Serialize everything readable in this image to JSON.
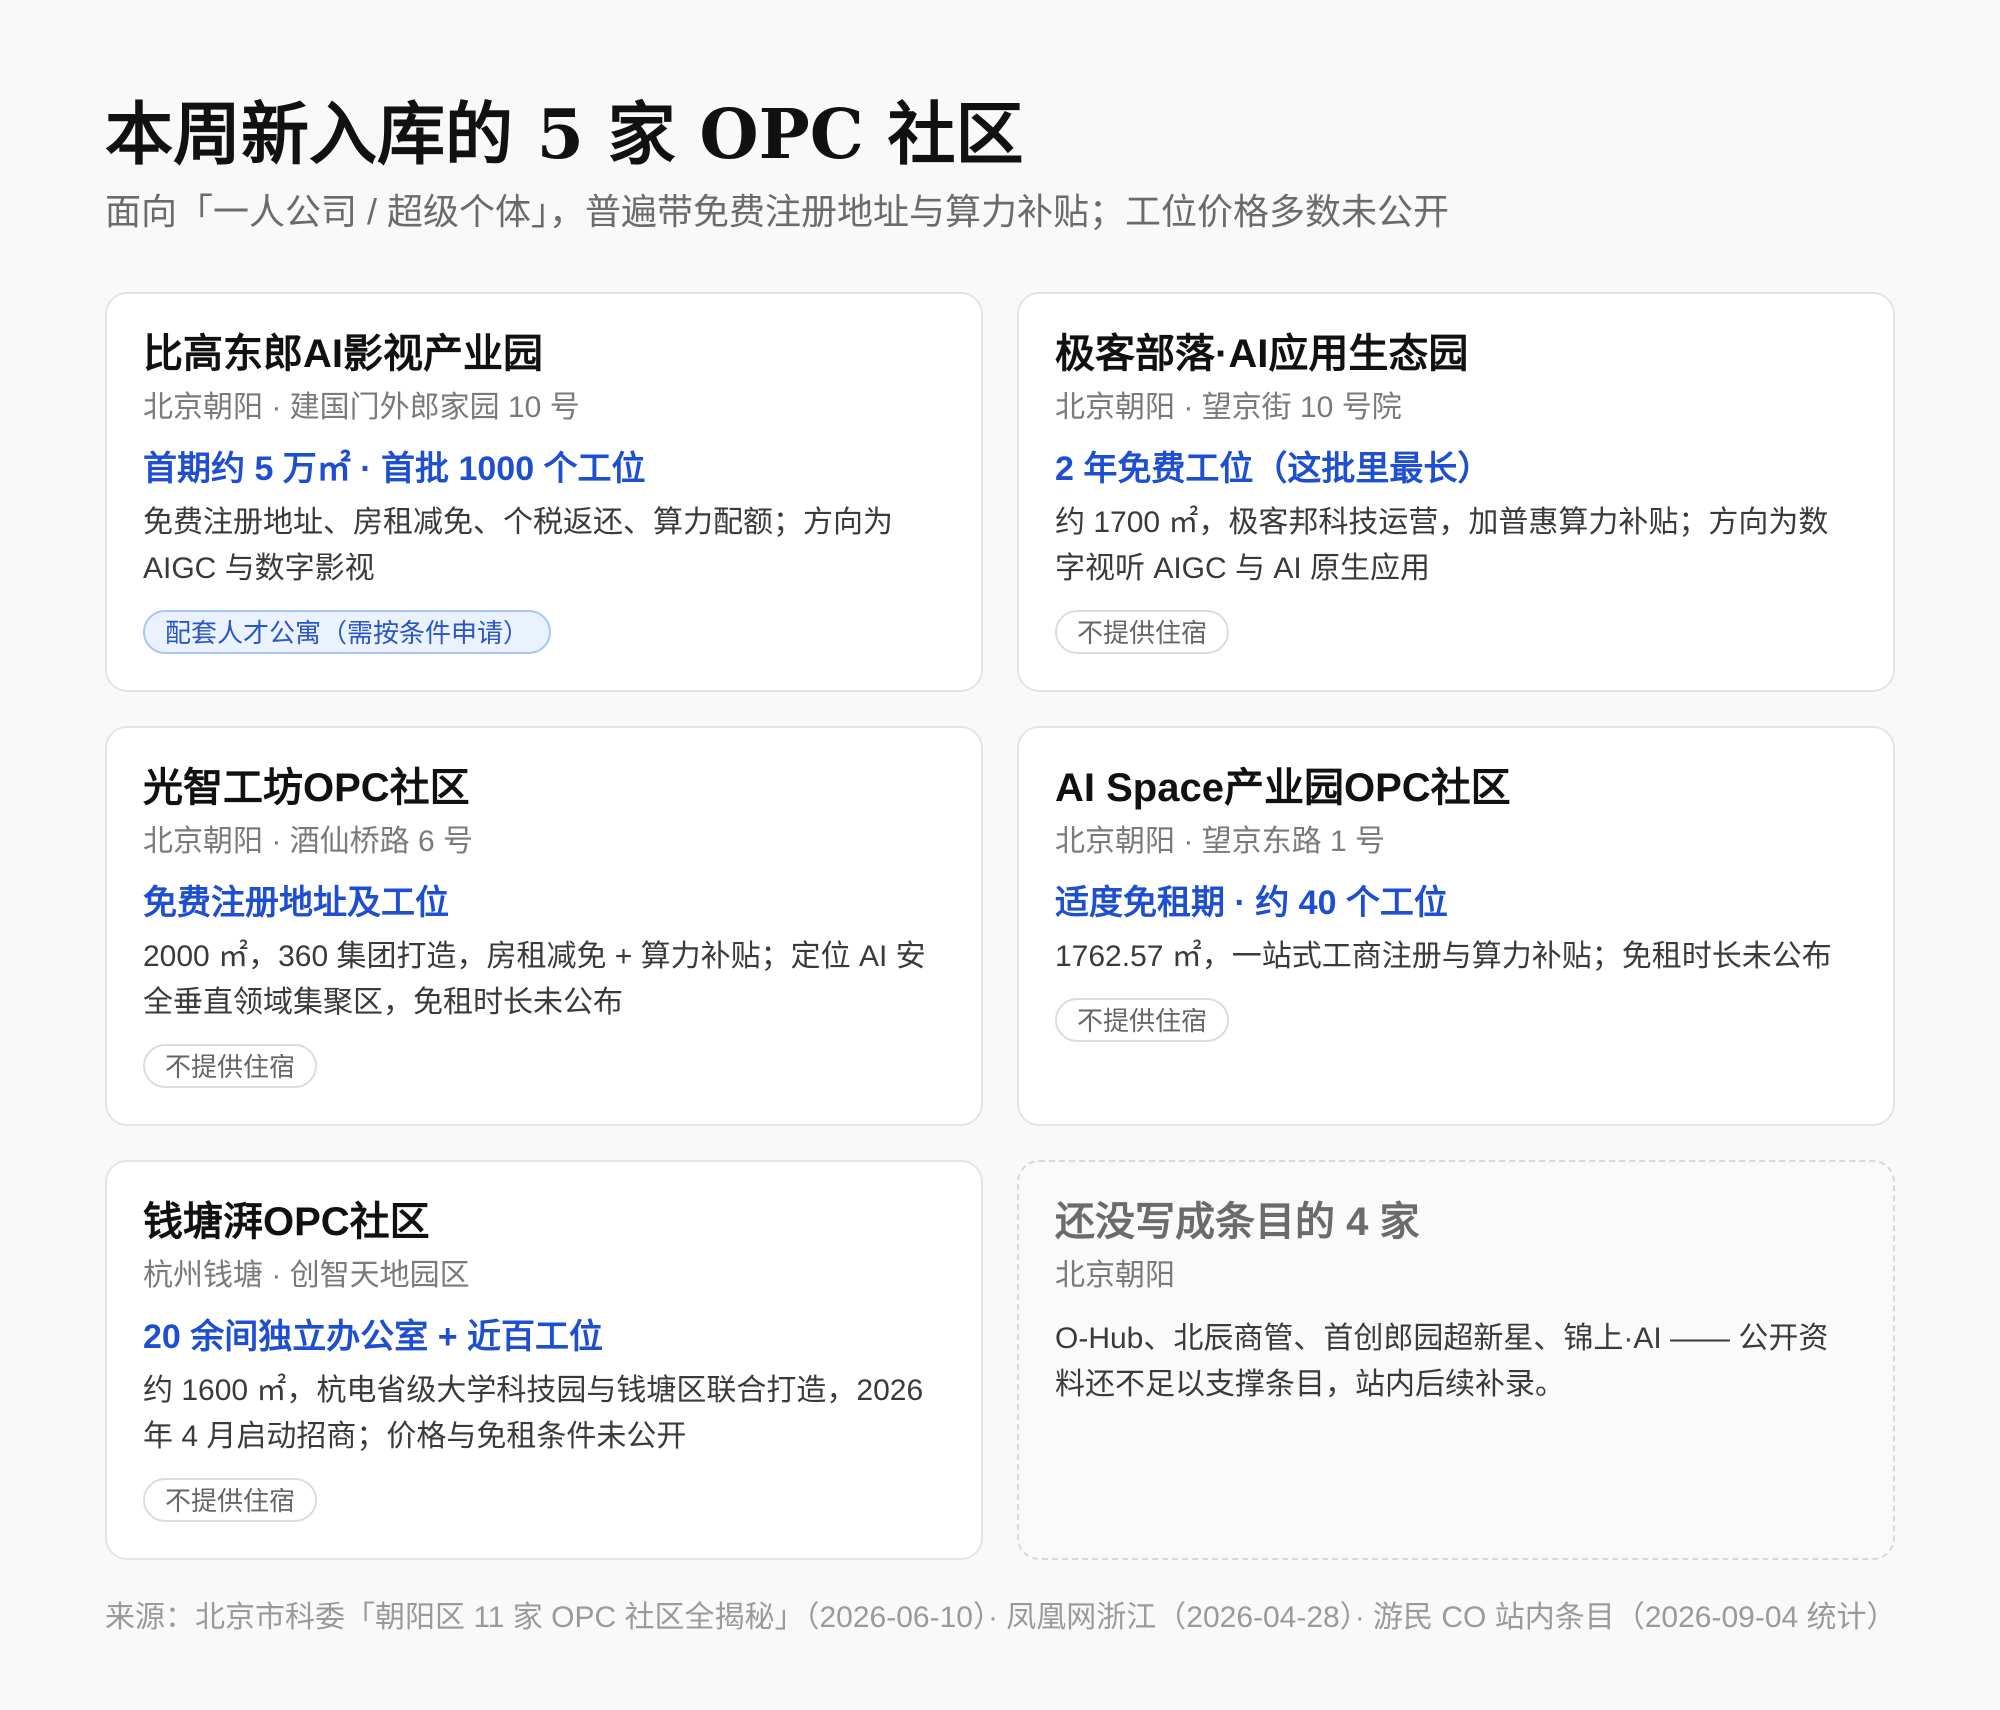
{
  "header": {
    "title": "本周新入库的 5 家 OPC 社区",
    "subtitle": "面向「一人公司 / 超级个体」，普遍带免费注册地址与算力补贴；工位价格多数未公开"
  },
  "cards": [
    {
      "title": "比高东郎AI影视产业园",
      "location": "北京朝阳 · 建国门外郎家园 10 号",
      "highlight": "首期约 5 万㎡ · 首批 1000 个工位",
      "description": "免费注册地址、房租减免、个税返还、算力配额；方向为 AIGC 与数字影视",
      "tag": "配套人才公寓（需按条件申请）",
      "tag_style": "accent"
    },
    {
      "title": "极客部落·AI应用生态园",
      "location": "北京朝阳 · 望京街 10 号院",
      "highlight": "2 年免费工位（这批里最长）",
      "description": "约 1700 ㎡，极客邦科技运营，加普惠算力补贴；方向为数字视听 AIGC 与 AI 原生应用",
      "tag": "不提供住宿",
      "tag_style": "neutral"
    },
    {
      "title": "光智工坊OPC社区",
      "location": "北京朝阳 · 酒仙桥路 6 号",
      "highlight": "免费注册地址及工位",
      "description": "2000 ㎡，360 集团打造，房租减免 + 算力补贴；定位 AI 安全垂直领域集聚区，免租时长未公布",
      "tag": "不提供住宿",
      "tag_style": "neutral"
    },
    {
      "title": "AI Space产业园OPC社区",
      "location": "北京朝阳 · 望京东路 1 号",
      "highlight": "适度免租期 · 约 40 个工位",
      "description": "1762.57 ㎡，一站式工商注册与算力补贴；免租时长未公布",
      "tag": "不提供住宿",
      "tag_style": "neutral"
    },
    {
      "title": "钱塘湃OPC社区",
      "location": "杭州钱塘 · 创智天地园区",
      "highlight": "20 余间独立办公室 + 近百工位",
      "description": "约 1600 ㎡，杭电省级大学科技园与钱塘区联合打造，2026 年 4 月启动招商；价格与免租条件未公开",
      "tag": "不提供住宿",
      "tag_style": "neutral"
    }
  ],
  "pending": {
    "title": "还没写成条目的 4 家",
    "location": "北京朝阳",
    "description": "O-Hub、北辰商管、首创郎园超新星、锦上·AI —— 公开资料还不足以支撑条目，站内后续补录。"
  },
  "source": "来源：北京市科委「朝阳区 11 家 OPC 社区全揭秘」（2026-06-10）· 凤凰网浙江（2026-04-28）· 游民 CO 站内条目（2026-09-04 统计）",
  "colors": {
    "background": "#f9f9f9",
    "highlight": "#1f4fd1",
    "muted_text": "#7a7a7a",
    "accent_tag_bg": "#eaf2fe",
    "accent_tag_border": "#a9c4f5"
  }
}
